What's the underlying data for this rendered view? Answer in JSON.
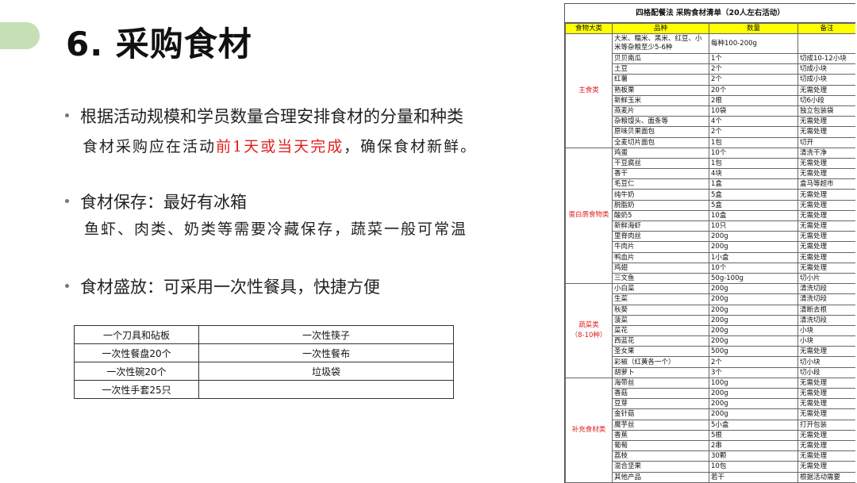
{
  "slide": {
    "title": "6. 采购食材",
    "bullets": [
      {
        "label": "根据活动规模和学员数量合理安排食材的分量和种类"
      },
      {
        "label": "食材保存：最好有冰箱"
      },
      {
        "label": "食材盛放：可采用一次性餐具，快捷方便"
      }
    ],
    "note1_pre": "食材采购应在活动",
    "note1_red": "前1天或当天完成",
    "note1_post": "，确保食材新鲜。",
    "note2": "鱼虾、肉类、奶类等需要冷藏保存，蔬菜一般可常温"
  },
  "tools": [
    [
      "一个刀具和砧板",
      "一次性筷子"
    ],
    [
      "一次性餐盘20个",
      "一次性餐布"
    ],
    [
      "一次性碗20个",
      "垃圾袋"
    ],
    [
      "一次性手套25只",
      ""
    ]
  ],
  "sheet": {
    "title": "四格配餐法 采购食材清单（20人左右活动）",
    "headers": [
      "食物大类",
      "品种",
      "数量",
      "备注"
    ],
    "groups": [
      {
        "category": "主食类",
        "rows": [
          [
            "大米、糯米、黑米、红豆、小米等杂粮至少5-6种",
            "每种100-200g",
            ""
          ],
          [
            "贝贝南瓜",
            "1个",
            "切成10-12小块"
          ],
          [
            "土豆",
            "2个",
            "切成小块"
          ],
          [
            "红薯",
            "2个",
            "切成小块"
          ],
          [
            "熟板栗",
            "20个",
            "无需处理"
          ],
          [
            "新鲜玉米",
            "2根",
            "切6小段"
          ],
          [
            "燕麦片",
            "10袋",
            "独立包装袋"
          ],
          [
            "杂粮馒头、面条等",
            "4个",
            "无需处理"
          ],
          [
            "原味贝果面包",
            "2个",
            "无需处理"
          ],
          [
            "全麦切片面包",
            "1包",
            "切开"
          ]
        ]
      },
      {
        "category": "蛋白质食物类",
        "rows": [
          [
            "鸡蛋",
            "10个",
            "清洗干净"
          ],
          [
            "干豆腐丝",
            "1包",
            "无需处理"
          ],
          [
            "香干",
            "4块",
            "无需处理"
          ],
          [
            "毛豆仁",
            "1盒",
            "盒马等超市"
          ],
          [
            "纯牛奶",
            "5盒",
            "无需处理"
          ],
          [
            "脱脂奶",
            "5盒",
            "无需处理"
          ],
          [
            "酸奶5",
            "10盒",
            "无需处理"
          ],
          [
            "新鲜海虾",
            "10只",
            "无需处理"
          ],
          [
            "里脊肉丝",
            "200g",
            "无需处理"
          ],
          [
            "牛肉片",
            "200g",
            "无需处理"
          ],
          [
            "鸭血片",
            "1小盒",
            "无需处理"
          ],
          [
            "鸡翅",
            "10个",
            "无需处理"
          ],
          [
            "三文鱼",
            "50g-100g",
            "切小片"
          ]
        ]
      },
      {
        "category": "蔬菜类",
        "category2": "（8-10种）",
        "rows": [
          [
            "小白菜",
            "200g",
            "清洗切段"
          ],
          [
            "生菜",
            "200g",
            "清洗切段"
          ],
          [
            "秋葵",
            "200g",
            "清断去根"
          ],
          [
            "菠菜",
            "200g",
            "清洗切段"
          ],
          [
            "菜花",
            "200g",
            "小块"
          ],
          [
            "西蓝花",
            "200g",
            "小块"
          ],
          [
            "圣女果",
            "500g",
            "无需处理"
          ],
          [
            "彩椒（红黄各一个）",
            "2个",
            "切小块"
          ],
          [
            "胡萝卜",
            "3个",
            "切小段"
          ]
        ]
      },
      {
        "category": "补充食材类",
        "rows": [
          [
            "海带丝",
            "100g",
            "无需处理"
          ],
          [
            "香菇",
            "200g",
            "无需处理"
          ],
          [
            "豆芽",
            "200g",
            "无需处理"
          ],
          [
            "金针菇",
            "200g",
            "无需处理"
          ],
          [
            "魔芋丝",
            "5小盒",
            "打开包装"
          ],
          [
            "香蕉",
            "5根",
            "无需处理"
          ],
          [
            "葡萄",
            "2串",
            "无需处理"
          ],
          [
            "荔枝",
            "30颗",
            "无需处理"
          ],
          [
            "混合坚果",
            "10包",
            "无需处理"
          ],
          [
            "其他产品",
            "若干",
            "根据活动需要"
          ]
        ]
      }
    ]
  },
  "colors": {
    "accent": "#c6dfb4",
    "highlight": "#e02020",
    "header_bg": "#ffff00"
  }
}
